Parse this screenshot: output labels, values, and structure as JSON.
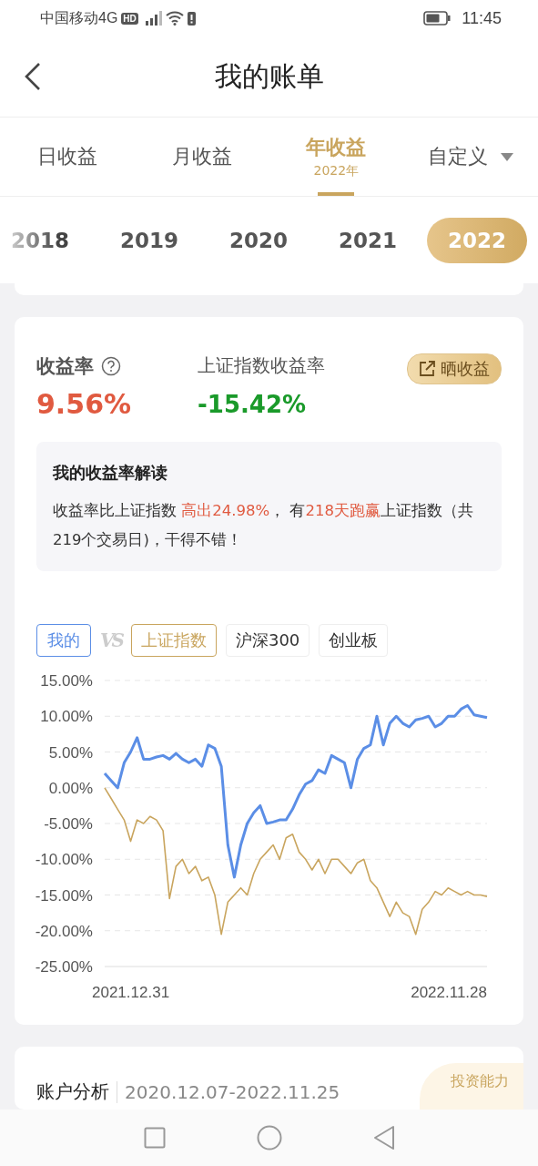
{
  "status_bar": {
    "carrier": "中国移动4G",
    "hd_badge": "HD",
    "time": "11:45"
  },
  "header": {
    "title": "我的账单"
  },
  "tabs": [
    {
      "label": "日收益",
      "selected": false,
      "dropdown": false
    },
    {
      "label": "月收益",
      "selected": false,
      "dropdown": false
    },
    {
      "label": "年收益",
      "sub": "2022年",
      "selected": true,
      "dropdown": false
    },
    {
      "label": "自定义",
      "selected": false,
      "dropdown": true
    }
  ],
  "years": [
    {
      "label": "2018",
      "selected": false
    },
    {
      "label": "2019",
      "selected": false
    },
    {
      "label": "2020",
      "selected": false
    },
    {
      "label": "2021",
      "selected": false
    },
    {
      "label": "2022",
      "selected": true
    }
  ],
  "returns": {
    "my_label": "收益率",
    "my_value": "9.56%",
    "index_label": "上证指数收益率",
    "index_value": "-15.42%",
    "share_button": "晒收益"
  },
  "interpretation": {
    "title": "我的收益率解读",
    "text": "收益率比上证指数 **高出24.98%**， 有**218天跑赢**上证指数（共219个交易日)，干得不错！"
  },
  "compare": {
    "vs": "VS",
    "items": [
      {
        "label": "沪深300",
        "selected": false
      },
      {
        "label": "创业板",
        "selected": false
      }
    ],
    "x_start": "2021.12.31",
    "x_end": "2022.11.28"
  },
  "chart_data": {
    "type": "line",
    "grid": true,
    "ylim": [
      -25,
      15
    ],
    "yticks": [
      {
        "value": 15,
        "label": "15.00%"
      },
      {
        "value": 10,
        "label": "10.00%"
      },
      {
        "value": 5,
        "label": "5.00%"
      },
      {
        "value": 0,
        "label": "0.00%"
      },
      {
        "value": -5,
        "label": "-5.00%"
      },
      {
        "value": -10,
        "label": "-10.00%"
      },
      {
        "value": -15,
        "label": "-15.00%"
      },
      {
        "value": -20,
        "label": "-20.00%"
      },
      {
        "value": -25,
        "label": "-25.00%"
      }
    ],
    "series": [
      {
        "name": "我的",
        "color": "#5b8ee6",
        "values": [
          2,
          1,
          0,
          3.5,
          5,
          7,
          4,
          4,
          4.3,
          4.5,
          4,
          4.8,
          4,
          3.5,
          4,
          3,
          6,
          5.5,
          3,
          -8,
          -12.5,
          -8,
          -5,
          -3.5,
          -2.5,
          -5,
          -4.8,
          -4.5,
          -4.5,
          -3,
          -1,
          0.5,
          1,
          2.5,
          2,
          4.5,
          4,
          3.5,
          0,
          4,
          5.5,
          6,
          10,
          6,
          9,
          10,
          9,
          8.5,
          9.5,
          9.7,
          10,
          8.5,
          9,
          10,
          10,
          11,
          11.5,
          10.2,
          10,
          9.8
        ]
      },
      {
        "name": "上证指数",
        "color": "#c9a55e",
        "values": [
          0,
          -1.5,
          -3,
          -4.5,
          -7.5,
          -4.5,
          -5,
          -4,
          -4.5,
          -6,
          -15.5,
          -11,
          -10,
          -12,
          -11,
          -13,
          -12.5,
          -15,
          -20.5,
          -16,
          -15,
          -14,
          -15,
          -12,
          -10,
          -9,
          -8,
          -10,
          -7,
          -6.5,
          -9,
          -10,
          -11.5,
          -10,
          -12,
          -10,
          -10,
          -11,
          -12,
          -10.5,
          -10,
          -13,
          -14,
          -16,
          -18,
          -16,
          -17.5,
          -18,
          -20.5,
          -17,
          -16,
          -14.5,
          -15,
          -14,
          -14.5,
          -15,
          -14.5,
          -15,
          -15,
          -15.2
        ]
      }
    ]
  },
  "account": {
    "title": "账户分析",
    "range": "2020.12.07-2022.11.25",
    "badge": "投资能力"
  }
}
